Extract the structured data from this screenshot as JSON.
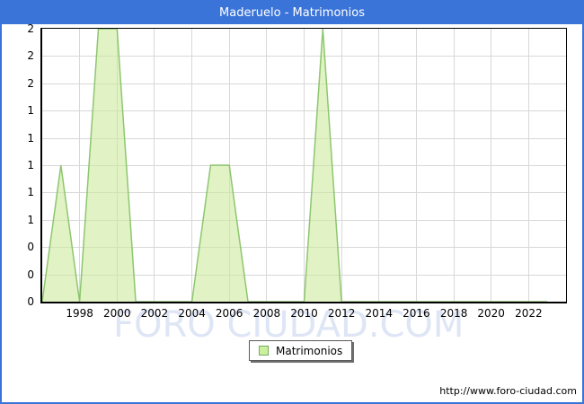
{
  "title_bar": {
    "text": "Maderuelo - Matrimonios"
  },
  "chart_data": {
    "type": "area",
    "title": "Maderuelo - Matrimonios",
    "series_name": "Matrimonios",
    "x": [
      1996,
      1997,
      1998,
      1999,
      2000,
      2001,
      2002,
      2003,
      2004,
      2005,
      2006,
      2007,
      2008,
      2009,
      2010,
      2011,
      2012,
      2013,
      2014,
      2015,
      2016,
      2017,
      2018,
      2019,
      2020,
      2021,
      2022,
      2023
    ],
    "values": [
      0,
      1,
      0,
      2,
      2,
      0,
      0,
      0,
      0,
      1,
      1,
      0,
      0,
      0,
      0,
      2,
      0,
      0,
      0,
      0,
      0,
      0,
      0,
      0,
      0,
      0,
      0,
      0
    ],
    "x_domain": [
      1996,
      2024
    ],
    "ylim": [
      0,
      2
    ],
    "y_tick_step": 0.2,
    "y_tick_labels": [
      "2",
      "2",
      "2",
      "1",
      "1",
      "1",
      "1",
      "1",
      "0",
      "0",
      "0"
    ],
    "x_tick_labels": [
      "1998",
      "2000",
      "2002",
      "2004",
      "2006",
      "2008",
      "2010",
      "2012",
      "2014",
      "2016",
      "2018",
      "2020",
      "2022"
    ],
    "grid": true,
    "legend_position": "bottom-center",
    "grid_color": "#d8d8d8",
    "fill_color": "#cdeb9d",
    "fill_opacity": 0.6,
    "line_color": "#7dbd5d",
    "line_opacity": 0.85
  },
  "legend": {
    "label": "Matrimonios",
    "swatch_fill": "#cdf0a0",
    "swatch_border": "#74ad56"
  },
  "watermark": {
    "text": "FORO CIUDAD.COM"
  },
  "footer": {
    "url": "http://www.foro-ciudad.com"
  },
  "colors": {
    "accent_blue": "#3b74d8",
    "axis_black": "#000000"
  }
}
